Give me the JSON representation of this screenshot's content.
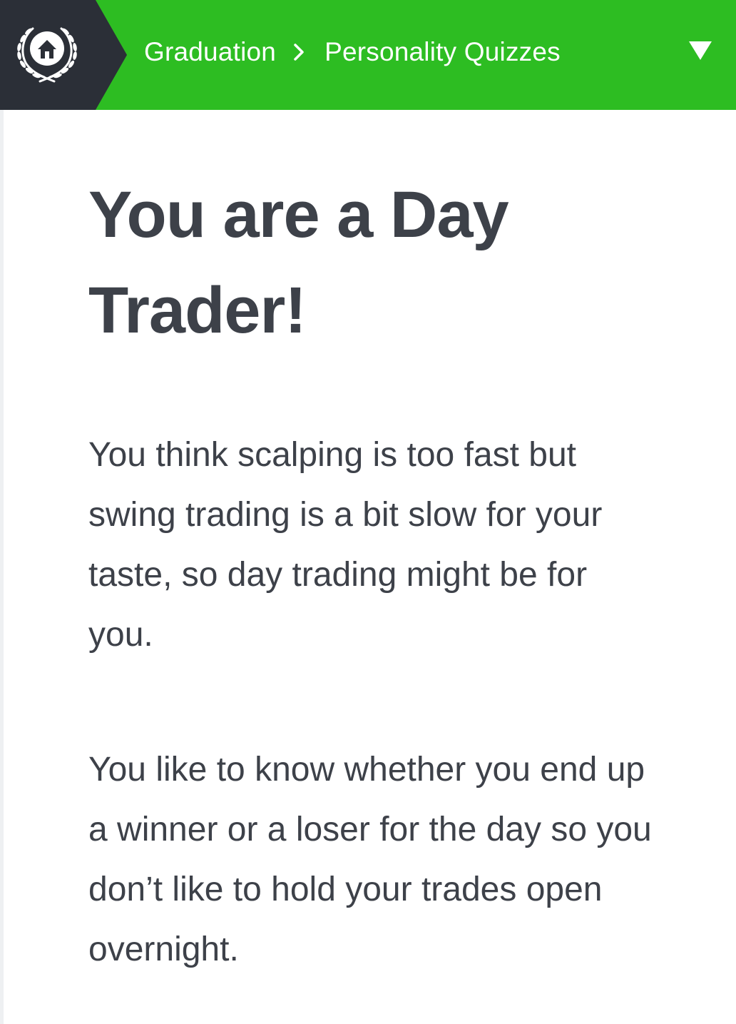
{
  "header": {
    "home_icon": "laurel-house-icon",
    "breadcrumb": [
      {
        "label": "Graduation"
      },
      {
        "label": "Personality Quizzes"
      }
    ],
    "separator_icon": "chevron-right-icon",
    "dropdown_icon": "triangle-down-icon"
  },
  "colors": {
    "header_green": "#2dbd22",
    "home_block_dark": "#2b2f37",
    "text_dark": "#3d4149"
  },
  "main": {
    "title": "You are a Day Trader!",
    "paragraphs": [
      "You think scalping is too fast but swing trading is a bit slow for your taste, so day trading might be for you.",
      "You like to know whether you end up a winner or a loser for the day so you don’t like to hold your trades open overnight."
    ]
  }
}
